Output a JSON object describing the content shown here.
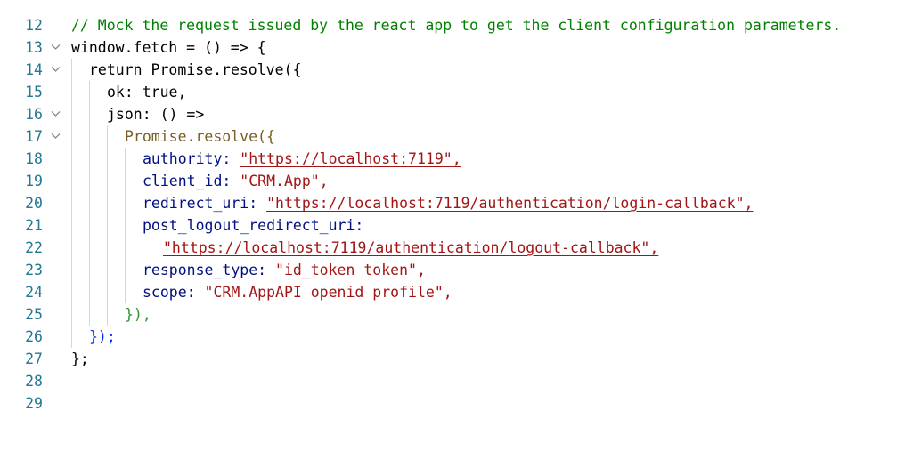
{
  "editor": {
    "lines": [
      {
        "num": "12"
      },
      {
        "num": "13",
        "code": "// Mock the request issued by the react app to get the client configuration parameters."
      },
      {
        "num": "14",
        "code": "window.fetch = () => {"
      },
      {
        "num": "15",
        "code": "return Promise.resolve({"
      },
      {
        "num": "16",
        "code": "ok: true,"
      },
      {
        "num": "17",
        "code": "json: () =>"
      },
      {
        "num": "18",
        "code": "Promise.resolve({"
      },
      {
        "num": "19",
        "key": "authority: ",
        "value": "\"https://localhost:7119\","
      },
      {
        "num": "20",
        "key": "client_id: ",
        "value": "\"CRM.App\","
      },
      {
        "num": "21",
        "key": "redirect_uri: ",
        "value": "\"https://localhost:7119/authentication/login-callback\","
      },
      {
        "num": "22",
        "key": "post_logout_redirect_uri:"
      },
      {
        "num": "23",
        "value": "\"https://localhost:7119/authentication/logout-callback\","
      },
      {
        "num": "24",
        "key": "response_type: ",
        "value": "\"id_token token\","
      },
      {
        "num": "25",
        "key": "scope: ",
        "value": "\"CRM.AppAPI openid profile\","
      },
      {
        "num": "26",
        "code": "}),"
      },
      {
        "num": "27",
        "code": "});"
      },
      {
        "num": "28",
        "code": "};"
      },
      {
        "num": "29"
      }
    ],
    "fold_icon": "chevron-down-icon",
    "colors": {
      "line_number": "#237893",
      "comment": "#008000",
      "keyword": "#0000ff",
      "string": "#a31515",
      "property": "#001080",
      "function": "#795e26"
    }
  }
}
